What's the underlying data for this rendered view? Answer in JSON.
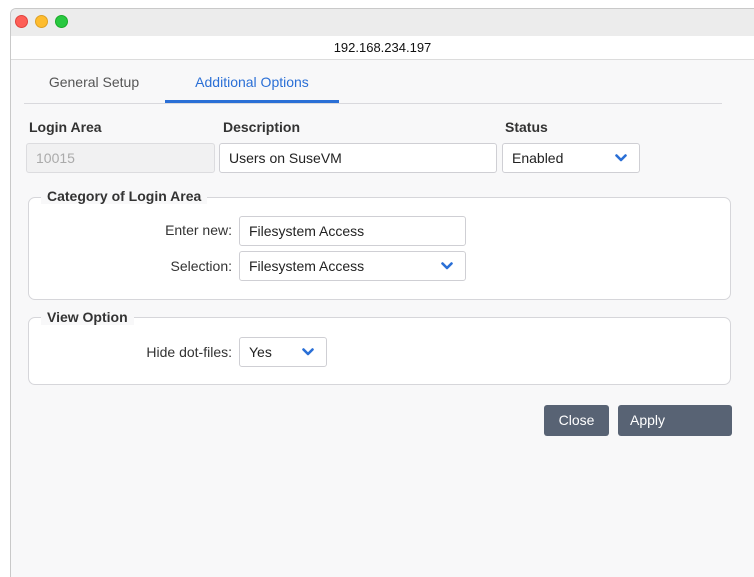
{
  "window": {
    "address": "192.168.234.197"
  },
  "tabs": [
    {
      "label": "General Setup",
      "active": false
    },
    {
      "label": "Additional Options",
      "active": true
    }
  ],
  "header": {
    "login_area_label": "Login Area",
    "login_area_value": "10015",
    "description_label": "Description",
    "description_value": "Users on SuseVM",
    "status_label": "Status",
    "status_value": "Enabled"
  },
  "category": {
    "title": "Category of Login Area",
    "enter_new_label": "Enter new:",
    "enter_new_value": "Filesystem Access",
    "selection_label": "Selection:",
    "selection_value": "Filesystem Access"
  },
  "view_option": {
    "title": "View Option",
    "hide_dotfiles_label": "Hide dot-files:",
    "hide_dotfiles_value": "Yes"
  },
  "buttons": {
    "close": "Close",
    "apply": "Apply"
  },
  "colors": {
    "accent": "#2a6fd6",
    "button": "#586374",
    "traffic_close": "#fe5f57",
    "traffic_min": "#febc2e",
    "traffic_max": "#28c840"
  },
  "icons": {
    "dropdown": "chevron-down-icon"
  }
}
